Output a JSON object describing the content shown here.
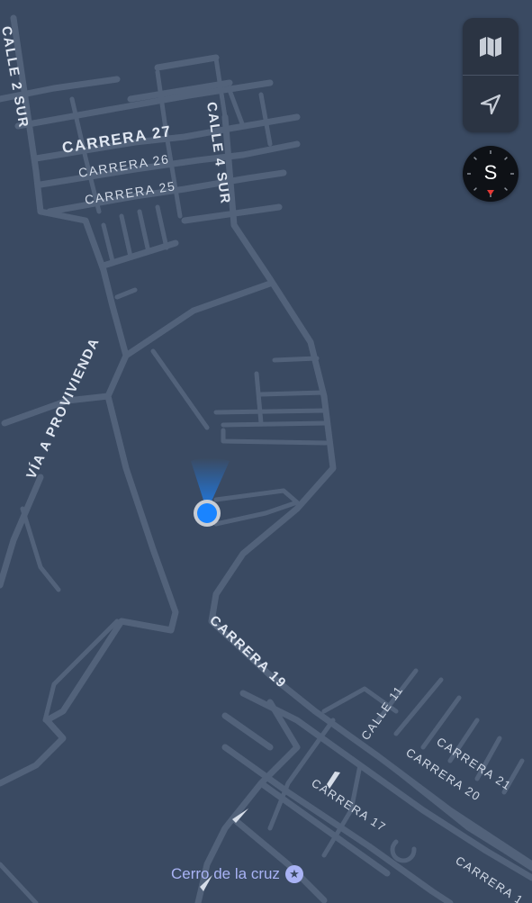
{
  "map": {
    "street_labels": {
      "calle_2_sur": "CALLE 2 SUR",
      "calle_4_sur": "CALLE 4 SUR",
      "carrera_27": "CARRERA 27",
      "carrera_26": "CARRERA 26",
      "carrera_25": "CARRERA 25",
      "via_a_providencia": "VÍA A PROVIVIENDA",
      "carrera_19": "CARRERA 19",
      "calle_11": "CALLE 11",
      "carrera_21": "CARRERA 21",
      "carrera_20": "CARRERA 20",
      "carrera_17": "CARRERA 17",
      "carrera_partial": "CARRERA 1"
    },
    "poi": {
      "name": "Cerro de la cruz",
      "icon": "star-icon"
    },
    "colors": {
      "background": "#3a4a62",
      "road": "#52627a",
      "user_location": "#1a84ff",
      "poi": "#a9b3f5"
    }
  },
  "controls": {
    "map_mode_icon": "map-icon",
    "locate_icon": "location-arrow-icon",
    "compass_heading": "S"
  }
}
